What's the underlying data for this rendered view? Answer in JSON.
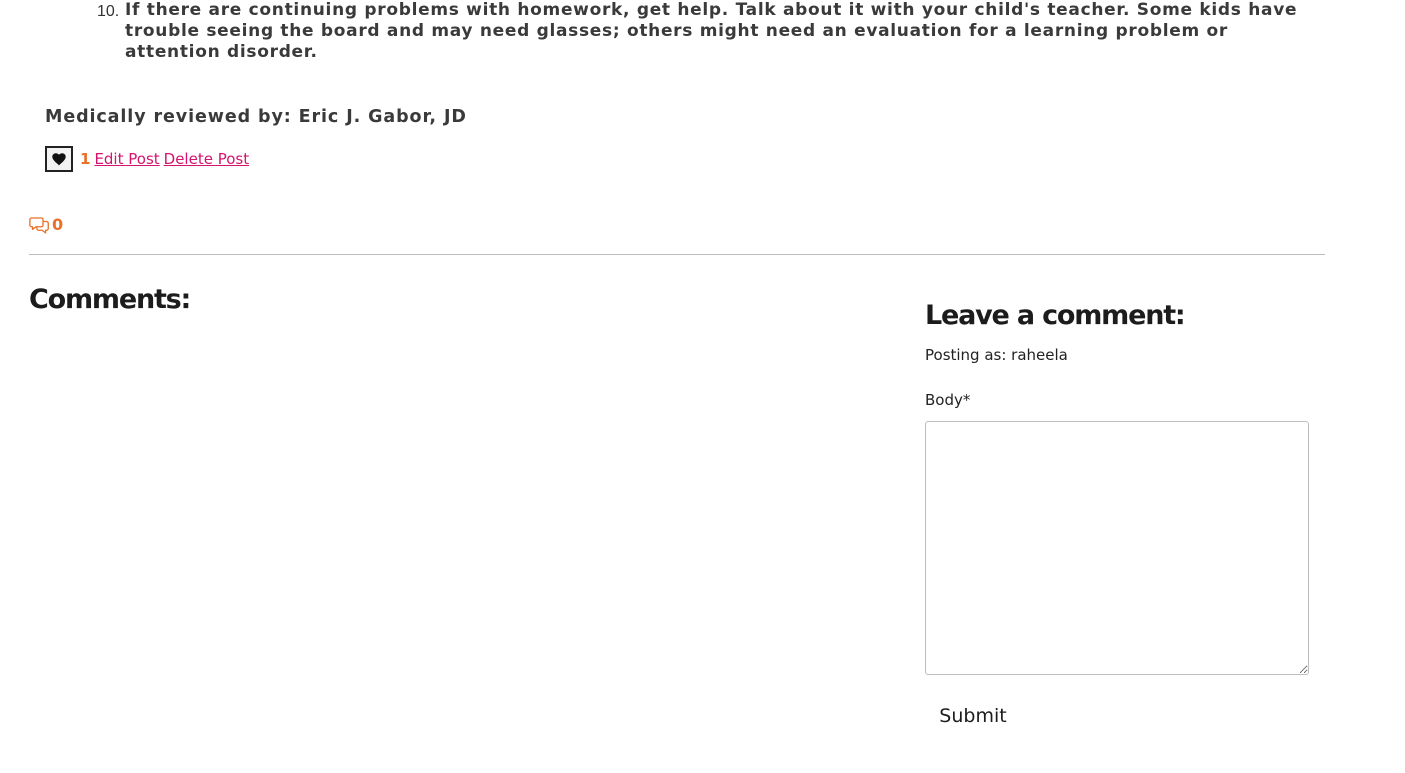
{
  "article": {
    "list_item": {
      "number": "10.",
      "text": "If there are continuing problems with homework, get help. Talk about it with your child's teacher. Some kids have trouble seeing the board and may need glasses; others might need an evaluation for a learning problem or attention disorder."
    },
    "reviewed_by": "Medically reviewed by: Eric J. Gabor, JD"
  },
  "post_actions": {
    "like_icon": "heart-icon",
    "like_count": "1",
    "edit_label": "Edit Post",
    "delete_label": "Delete Post"
  },
  "comments_summary": {
    "icon": "comments-icon",
    "count": "0"
  },
  "comments": {
    "heading": "Comments:"
  },
  "comment_form": {
    "heading": "Leave a comment:",
    "posting_as": "Posting as: raheela",
    "body_label": "Body*",
    "body_value": "",
    "submit_label": "Submit"
  },
  "colors": {
    "accent_orange": "#e8702a",
    "link_pink": "#d4146e"
  }
}
